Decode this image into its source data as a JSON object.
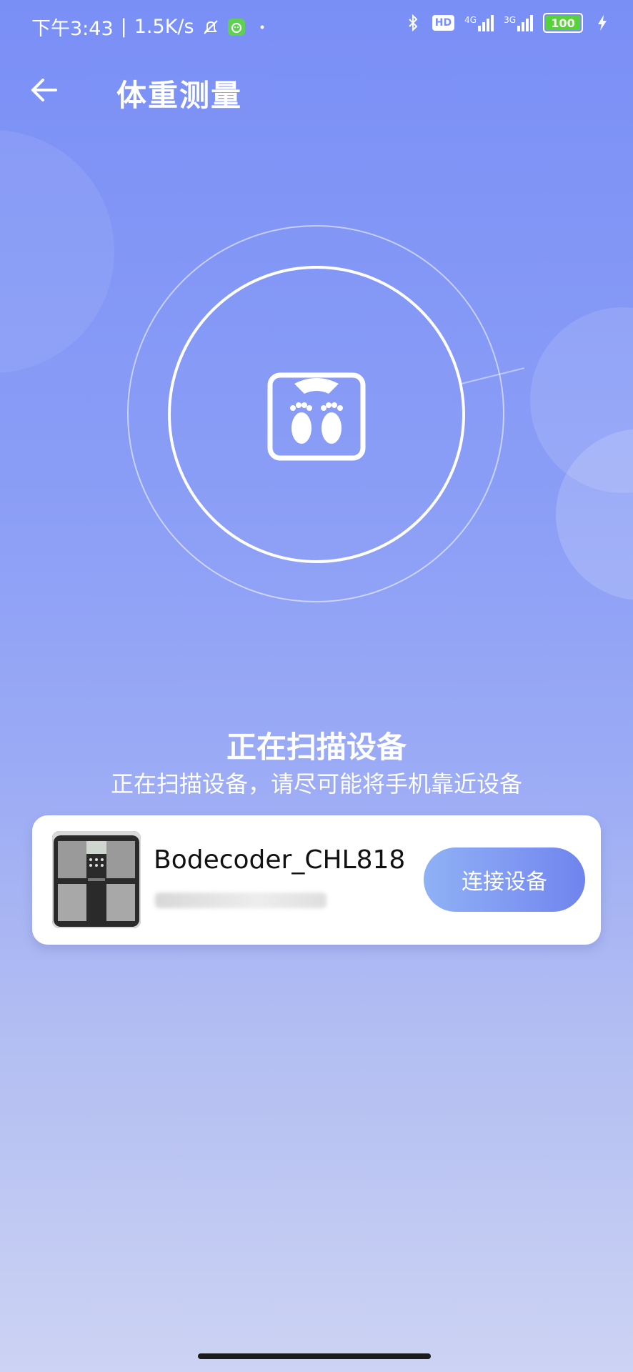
{
  "status_bar": {
    "time": "下午3:43",
    "separator": "|",
    "net_speed": "1.5K/s",
    "battery_level": "100",
    "icons": [
      "bell-off-icon",
      "app-notification-icon",
      "dot-icon",
      "bluetooth-icon",
      "hd-icon",
      "signal-4g-icon",
      "signal-3g-icon",
      "battery-icon",
      "charging-icon"
    ],
    "hd_label": "HD",
    "signal1_label": "4G",
    "signal2_label": "3G",
    "battery_color": "#59d13b"
  },
  "header": {
    "title": "体重测量",
    "back_icon": "back-arrow-icon"
  },
  "scan": {
    "icon": "scale-footprints-icon",
    "title": "正在扫描设备",
    "subtitle": "正在扫描设备，请尽可能将手机靠近设备"
  },
  "device": {
    "name": "Bodecoder_CHL818",
    "connect_label": "连接设备",
    "image": "body-scale-device-image"
  },
  "colors": {
    "background_top": "#7a8ff6",
    "background_bottom": "#ccd3f3",
    "button_start": "#8fb1f5",
    "button_end": "#6f84ee"
  }
}
